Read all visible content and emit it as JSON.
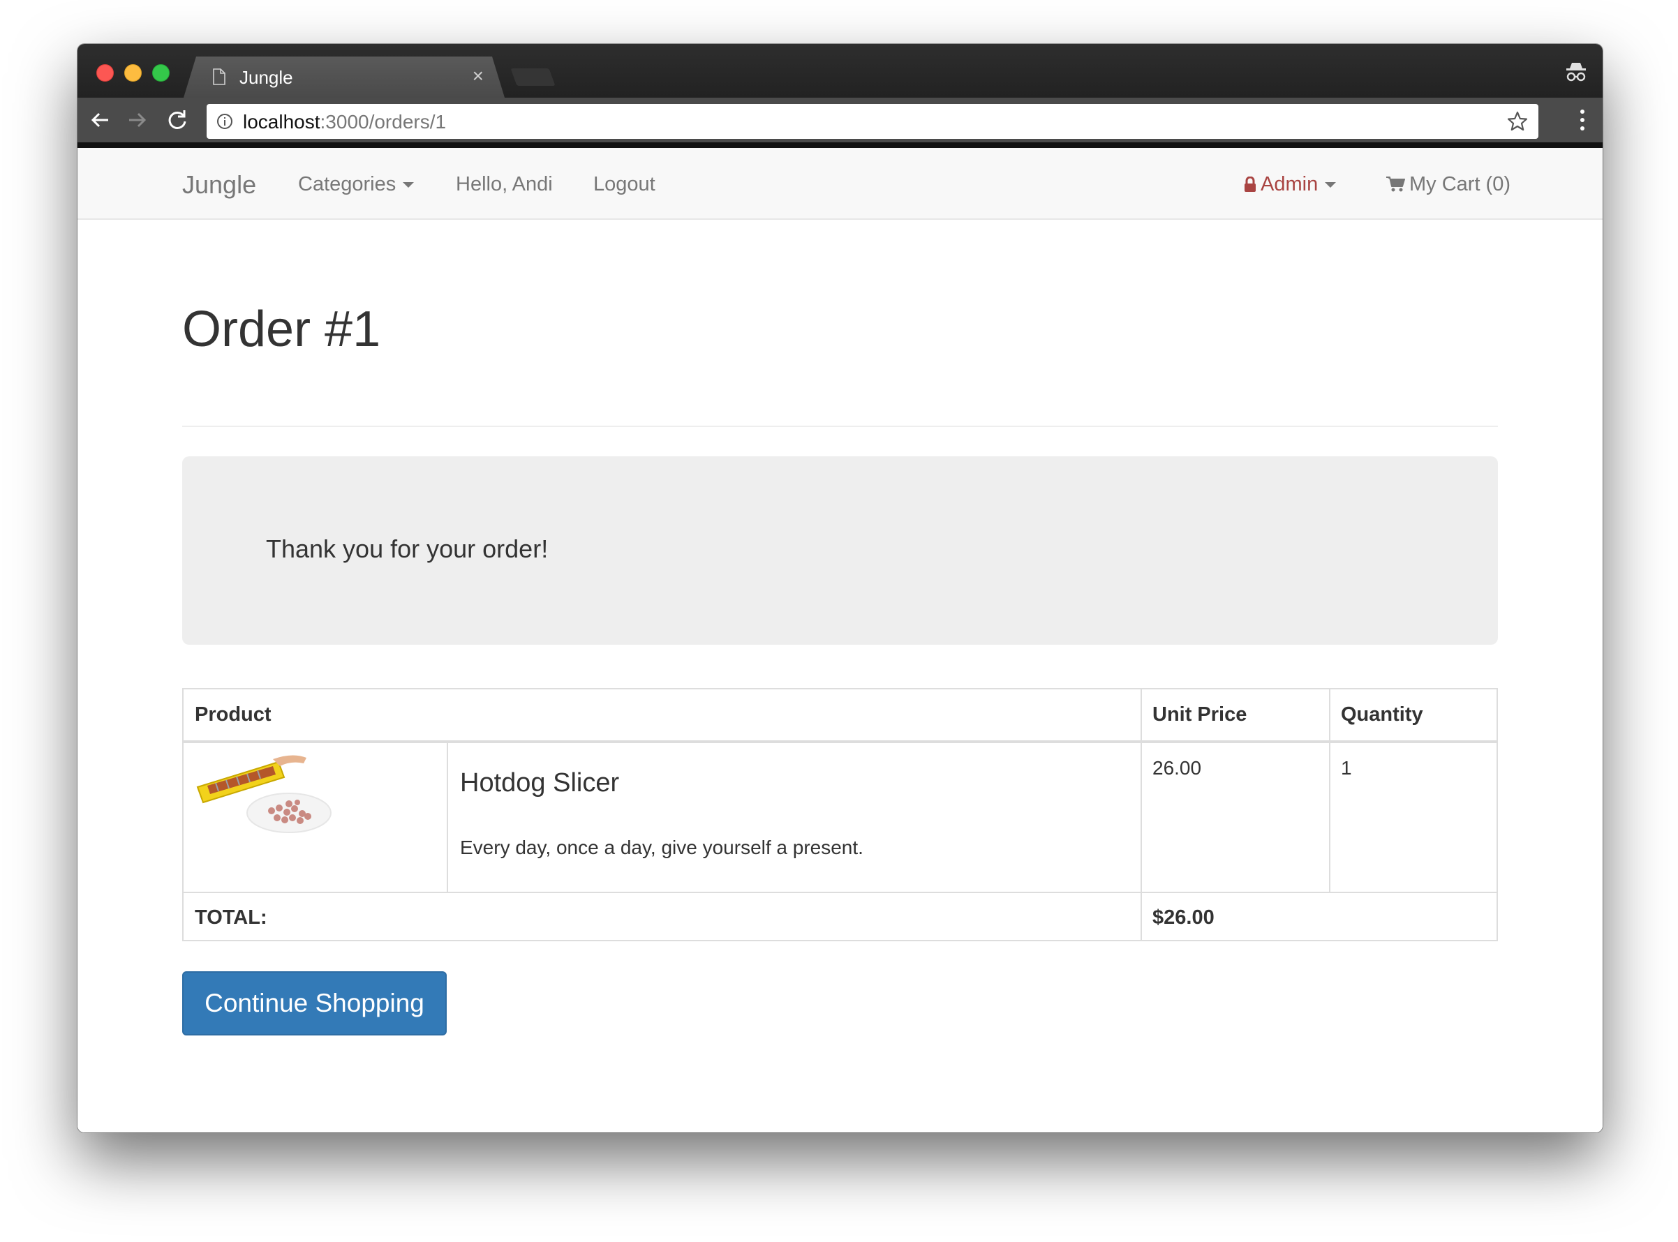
{
  "browser": {
    "tab_title": "Jungle",
    "url_host": "localhost",
    "url_path": ":3000/orders/1"
  },
  "nav": {
    "brand": "Jungle",
    "categories": "Categories",
    "greeting": "Hello, Andi",
    "logout": "Logout",
    "admin": "Admin",
    "cart": "My Cart (0)",
    "admin_color": "#a94442"
  },
  "order": {
    "title": "Order #1",
    "thank_you": "Thank you for your order!",
    "table": {
      "headers": [
        "Product",
        "Unit Price",
        "Quantity"
      ],
      "rows": [
        {
          "name": "Hotdog Slicer",
          "description": "Every day, once a day, give yourself a present.",
          "unit_price": "26.00",
          "quantity": "1"
        }
      ],
      "total_label": "TOTAL:",
      "total_value": "$26.00"
    },
    "continue_button": "Continue Shopping",
    "primary_color": "#337ab7"
  },
  "icons": [
    "file-icon",
    "close-icon",
    "incognito-icon",
    "back-icon",
    "forward-icon",
    "reload-icon",
    "info-icon",
    "star-icon",
    "menu-icon",
    "lock-icon",
    "cart-icon",
    "caret-down-icon"
  ]
}
